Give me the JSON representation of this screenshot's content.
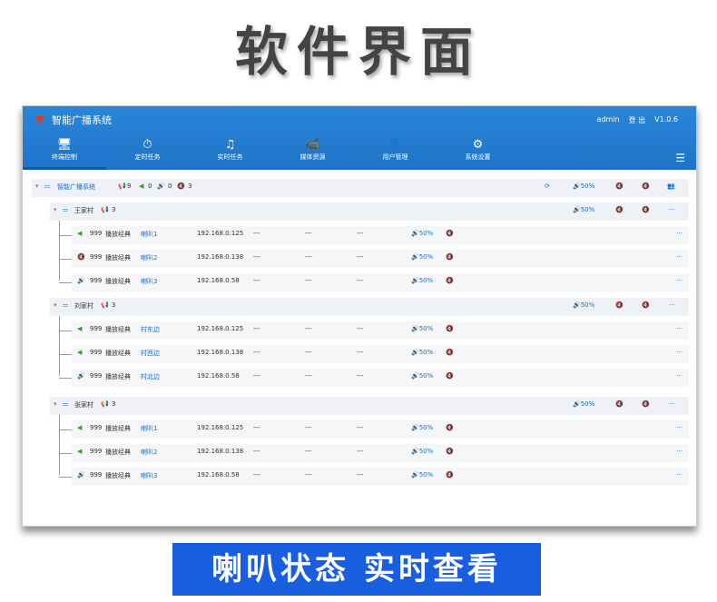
{
  "headline": "软件界面",
  "app": {
    "title": "智能广播系统",
    "user": "admin",
    "logout": "登 出",
    "version": "V1.0.6"
  },
  "nav": [
    {
      "label": "终端控制",
      "icon": "🖥"
    },
    {
      "label": "定时任务",
      "icon": "⏱"
    },
    {
      "label": "实时任务",
      "icon": "♫"
    },
    {
      "label": "媒体资源",
      "icon": "📹"
    },
    {
      "label": "用户管理",
      "icon": "👤"
    },
    {
      "label": "系统设置",
      "icon": "⚙"
    }
  ],
  "root": {
    "name": "智能广播系统",
    "cnt_a": "9",
    "cnt_b": "0",
    "cnt_c": "0",
    "cnt_d": "3",
    "volume": "50%"
  },
  "groups": [
    {
      "name": "王家村",
      "count": "3",
      "volume": "50%",
      "speakers": [
        {
          "num": "999",
          "status": "播放经典",
          "name": "喇叭1",
          "ip": "192.168.0.125",
          "d1": "---",
          "d2": "---",
          "d3": "---",
          "volume": "50%",
          "state": "mute"
        },
        {
          "num": "999",
          "status": "播放经典",
          "name": "喇叭2",
          "ip": "192.168.0.138",
          "d1": "---",
          "d2": "---",
          "d3": "---",
          "volume": "50%",
          "state": "off"
        },
        {
          "num": "999",
          "status": "播放经典",
          "name": "喇叭3",
          "ip": "192.168.0.58",
          "d1": "---",
          "d2": "---",
          "d3": "---",
          "volume": "50%",
          "state": "on"
        }
      ]
    },
    {
      "name": "刘家村",
      "count": "3",
      "volume": "50%",
      "speakers": [
        {
          "num": "999",
          "status": "播放经典",
          "name": "村东边",
          "ip": "192.168.0.125",
          "d1": "---",
          "d2": "---",
          "d3": "---",
          "volume": "50%",
          "state": "mute"
        },
        {
          "num": "999",
          "status": "播放经典",
          "name": "村西边",
          "ip": "192.168.0.138",
          "d1": "---",
          "d2": "---",
          "d3": "---",
          "volume": "50%",
          "state": "mute"
        },
        {
          "num": "999",
          "status": "播放经典",
          "name": "村北边",
          "ip": "192.168.0.58",
          "d1": "---",
          "d2": "---",
          "d3": "---",
          "volume": "50%",
          "state": "on"
        }
      ]
    },
    {
      "name": "张家村",
      "count": "3",
      "volume": "50%",
      "speakers": [
        {
          "num": "999",
          "status": "播放经典",
          "name": "喇叭1",
          "ip": "192.168.0.125",
          "d1": "---",
          "d2": "---",
          "d3": "---",
          "volume": "50%",
          "state": "mute"
        },
        {
          "num": "999",
          "status": "播放经典",
          "name": "喇叭2",
          "ip": "192.168.0.138",
          "d1": "---",
          "d2": "---",
          "d3": "---",
          "volume": "50%",
          "state": "mute"
        },
        {
          "num": "999",
          "status": "播放经典",
          "name": "喇叭3",
          "ip": "192.168.0.58",
          "d1": "---",
          "d2": "---",
          "d3": "---",
          "volume": "50%",
          "state": "on"
        }
      ]
    }
  ],
  "more": "···",
  "banner": "喇叭状态 实时查看"
}
